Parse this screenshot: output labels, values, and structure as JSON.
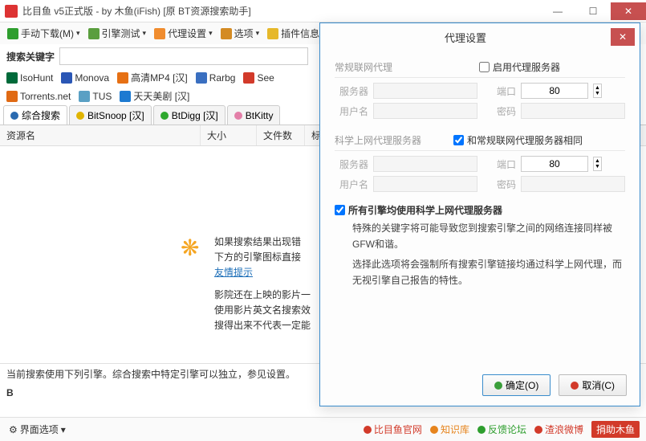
{
  "window": {
    "title": "比目鱼 v5正式版 - by 木鱼(iFish) [原 BT资源搜索助手]"
  },
  "toolbar": {
    "items": [
      {
        "label": "手动下载(M)",
        "icon": "#2e9e2e"
      },
      {
        "label": "引擎测试",
        "icon": "#5a9e3e"
      },
      {
        "label": "代理设置",
        "icon": "#f08c2e"
      },
      {
        "label": "选项",
        "icon": "#d48b23"
      },
      {
        "label": "插件信息",
        "icon": "#e6b82a"
      }
    ]
  },
  "search": {
    "label": "搜索关键字"
  },
  "engines_row1": [
    {
      "label": "IsoHunt",
      "color": "#006a3a"
    },
    {
      "label": "Monova",
      "color": "#2a56b5"
    },
    {
      "label": "高清MP4 [汉]",
      "color": "#e67014"
    },
    {
      "label": "Rarbg",
      "color": "#3a6fc0"
    },
    {
      "label": "See",
      "color": "#d23a2a"
    }
  ],
  "engines_row2": [
    {
      "label": "Torrents.net",
      "color": "#e06a14"
    },
    {
      "label": "TUS",
      "color": "#5aa0c4"
    },
    {
      "label": "天天美剧 [汉]",
      "color": "#1d7ad1"
    }
  ],
  "tabs": [
    {
      "label": "综合搜索",
      "color": "#2a6ab0",
      "active": true
    },
    {
      "label": "BitSnoop [汉]",
      "color": "#e0b400"
    },
    {
      "label": "BtDigg [汉]",
      "color": "#2ea82e"
    },
    {
      "label": "BtKitty",
      "color": "#e37fa8"
    }
  ],
  "columns": [
    "资源名",
    "大小",
    "文件数",
    "标"
  ],
  "placeholder": {
    "l1": "如果搜索结果出现错",
    "l2": "下方的引擎图标直接",
    "link": "友情提示",
    "l3": "影院还在上映的影片一",
    "l4": "使用影片英文名搜索效",
    "l5": "搜得出来不代表一定能"
  },
  "statusbar": "当前搜索使用下列引擎。综合搜索中特定引擎可以独立，参见设置。",
  "bottom": {
    "left": "界面选项",
    "links": [
      {
        "label": "比目鱼官网",
        "color": "#d23a2a"
      },
      {
        "label": "知识库",
        "color": "#e6841d"
      },
      {
        "label": "反馈论坛",
        "color": "#2e9e2e"
      },
      {
        "label": "渣浪微博",
        "color": "#d23a2a"
      }
    ],
    "donate": "捐助木鱼"
  },
  "dialog": {
    "title": "代理设置",
    "group1": {
      "legend": "常规联网代理",
      "check": "启用代理服务器",
      "server_label": "服务器",
      "port_label": "端口",
      "port_value": "80",
      "user_label": "用户名",
      "pass_label": "密码"
    },
    "group2": {
      "legend": "科学上网代理服务器",
      "check": "和常规联网代理服务器相同",
      "server_label": "服务器",
      "port_label": "端口",
      "port_value": "80",
      "user_label": "用户名",
      "pass_label": "密码"
    },
    "all_engines_check": "所有引擎均使用科学上网代理服务器",
    "note1": "特殊的关键字将可能导致您到搜索引擎之间的网络连接同样被GFW和谐。",
    "note2": "选择此选项将会强制所有搜索引擎链接均通过科学上网代理，而无视引擎自己报告的特性。",
    "ok": "确定(O)",
    "cancel": "取消(C)"
  }
}
